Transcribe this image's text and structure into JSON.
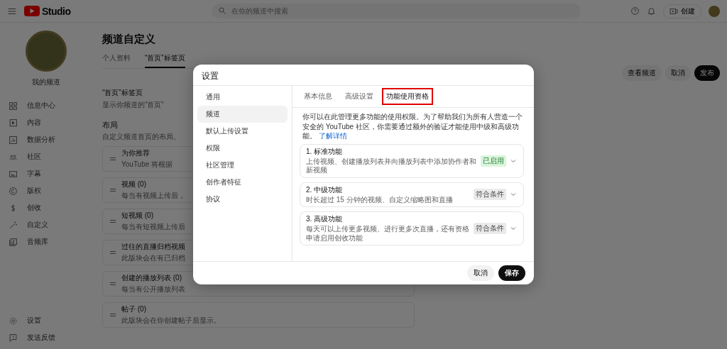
{
  "header": {
    "logo_text": "Studio",
    "search": {
      "placeholder": "在你的频道中搜索"
    },
    "create_button": "创建"
  },
  "sidebar": {
    "channel_name": "我的频道",
    "items": [
      {
        "label": "信息中心"
      },
      {
        "label": "内容"
      },
      {
        "label": "数据分析"
      },
      {
        "label": "社区"
      },
      {
        "label": "字幕"
      },
      {
        "label": "版权"
      },
      {
        "label": "创收"
      },
      {
        "label": "自定义"
      },
      {
        "label": "音频库"
      }
    ],
    "footer_items": [
      {
        "label": "设置"
      },
      {
        "label": "发送反馈"
      }
    ]
  },
  "main": {
    "title": "频道自定义",
    "tabs": [
      {
        "label": "个人资料",
        "selected": false
      },
      {
        "label": "“首页”标签页",
        "selected": true
      }
    ],
    "actions": [
      {
        "label": "查看频道",
        "kind": "secondary"
      },
      {
        "label": "取消",
        "kind": "secondary"
      },
      {
        "label": "发布",
        "kind": "primary"
      }
    ],
    "section_title": "“首页”标签页",
    "section_desc": "显示你频道的“首页”",
    "layout_title": "布局",
    "layout_desc": "自定义频道首页的布局。",
    "sections": [
      {
        "title": "为你推荐",
        "desc": "YouTube 将根据"
      },
      {
        "title": "视频 (0)",
        "desc": "每当有视频上传后，"
      },
      {
        "title": "短视频 (0)",
        "desc": "每当有短视频上传后"
      },
      {
        "title": "过往的直播归档视频",
        "desc": "此版块会在有已归档"
      },
      {
        "title": "创建的播放列表 (0)",
        "desc": "每当有公开播放列表"
      },
      {
        "title": "帖子 (0)",
        "desc": "此版块会在你创建帖子后显示。"
      }
    ]
  },
  "dialog": {
    "title": "设置",
    "nav": [
      {
        "label": "通用",
        "selected": false
      },
      {
        "label": "频道",
        "selected": true
      },
      {
        "label": "默认上传设置",
        "selected": false
      },
      {
        "label": "权限",
        "selected": false
      },
      {
        "label": "社区管理",
        "selected": false
      },
      {
        "label": "创作者特征",
        "selected": false
      },
      {
        "label": "协议",
        "selected": false
      }
    ],
    "tabs": [
      {
        "label": "基本信息",
        "selected": false,
        "highlighted": false
      },
      {
        "label": "高级设置",
        "selected": false,
        "highlighted": false
      },
      {
        "label": "功能使用资格",
        "selected": true,
        "highlighted": true
      }
    ],
    "intro": "你可以在此管理更多功能的使用权限。为了帮助我们为所有人营造一个安全的 YouTube 社区，你需要通过额外的验证才能使用中级和高级功能。",
    "intro_link": "了解详情",
    "features": [
      {
        "title": "1. 标准功能",
        "desc": "上传视频、创建播放列表并向播放列表中添加协作者和新视频",
        "status": "已启用",
        "enabled": true
      },
      {
        "title": "2. 中级功能",
        "desc": "时长超过 15 分钟的视频、自定义缩略图和直播",
        "status": "符合条件",
        "enabled": false
      },
      {
        "title": "3. 高级功能",
        "desc": "每天可以上传更多视频、进行更多次直播，还有资格申请启用创收功能",
        "status": "符合条件",
        "enabled": false
      }
    ],
    "buttons": [
      {
        "label": "取消",
        "kind": "secondary"
      },
      {
        "label": "保存",
        "kind": "primary"
      }
    ]
  }
}
